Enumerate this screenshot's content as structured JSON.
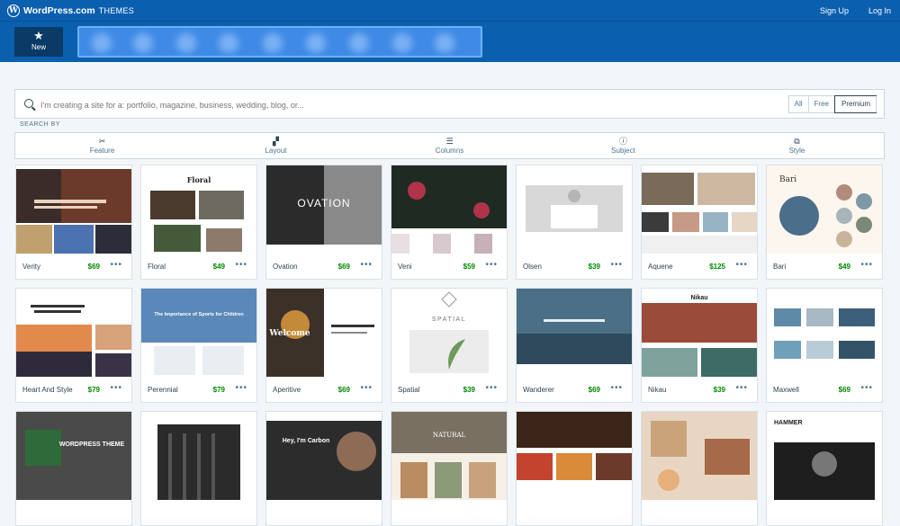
{
  "topbar": {
    "brand": "WordPress.com",
    "brand_sub": "THEMES",
    "signup": "Sign Up",
    "login": "Log In"
  },
  "new_button": {
    "label": "New",
    "icon": "star-icon"
  },
  "search": {
    "placeholder": "I'm creating a site for a: portfolio, magazine, business, wedding, blog, or...",
    "value": ""
  },
  "price_filter": {
    "options": [
      "All",
      "Free",
      "Premium"
    ],
    "selected": "Premium"
  },
  "search_by_label": "SEARCH BY",
  "filters": [
    {
      "label": "Feature",
      "icon": "tools-icon"
    },
    {
      "label": "Layout",
      "icon": "layout-icon"
    },
    {
      "label": "Columns",
      "icon": "columns-icon"
    },
    {
      "label": "Subject",
      "icon": "info-icon"
    },
    {
      "label": "Style",
      "icon": "style-icon"
    }
  ],
  "themes": [
    {
      "name": "Verity",
      "price": "$69"
    },
    {
      "name": "Floral",
      "price": "$49"
    },
    {
      "name": "Ovation",
      "price": "$69"
    },
    {
      "name": "Veni",
      "price": "$59"
    },
    {
      "name": "Olsen",
      "price": "$39"
    },
    {
      "name": "Aquene",
      "price": "$125"
    },
    {
      "name": "Bari",
      "price": "$49"
    },
    {
      "name": "Heart And Style",
      "price": "$79"
    },
    {
      "name": "Perennial",
      "price": "$79"
    },
    {
      "name": "Aperitive",
      "price": "$69"
    },
    {
      "name": "Spatial",
      "price": "$39"
    },
    {
      "name": "Wanderer",
      "price": "$69"
    },
    {
      "name": "Nikau",
      "price": "$39"
    },
    {
      "name": "Maxwell",
      "price": "$69"
    },
    {
      "name": "",
      "price": ""
    },
    {
      "name": "",
      "price": ""
    },
    {
      "name": "",
      "price": ""
    },
    {
      "name": "",
      "price": ""
    },
    {
      "name": "",
      "price": ""
    },
    {
      "name": "",
      "price": ""
    },
    {
      "name": "",
      "price": ""
    }
  ],
  "thumb_text": {
    "floral": "Floral",
    "ovation": "OVATION",
    "bari": "Bari",
    "perennial": "The Importance of Sports for Children",
    "aperitive": "Welcome",
    "spatial": "SPATIAL",
    "nikau": "Nikau",
    "carbon": "Hey, I'm Carbon",
    "hammer": "HAMMER",
    "wp_theme": "WORDPRESS THEME",
    "natural": "NATURAL"
  },
  "more_label": "•••"
}
